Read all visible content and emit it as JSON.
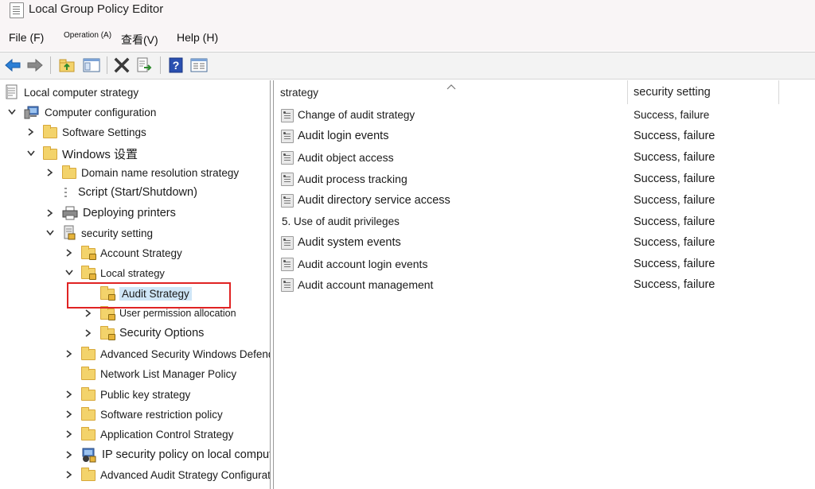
{
  "window": {
    "title": "Local Group Policy Editor"
  },
  "menu": {
    "file": "File (F)",
    "operation": "Operation (A)",
    "view": "查看(V)",
    "help": "Help (H)"
  },
  "toolbar": {
    "icons": [
      "back-arrow-icon",
      "forward-arrow-icon",
      "up-folder-icon",
      "show-hide-tree-icon",
      "delete-icon",
      "export-list-icon",
      "help-icon",
      "properties-pane-icon"
    ]
  },
  "tree": {
    "root": "Local computer strategy",
    "computer_config": "Computer configuration",
    "software_settings": "Software Settings",
    "windows_settings": "Windows 设置",
    "domain_name_resolution": "Domain name resolution strategy",
    "script": "Script (Start/Shutdown)",
    "deploying_printers": "Deploying printers",
    "security_setting": "security setting",
    "account_strategy": "Account Strategy",
    "local_strategy": "Local strategy",
    "audit_strategy": "Audit Strategy",
    "user_permission": "User permission allocation",
    "security_options": "Security Options",
    "advanced_security_defender": "Advanced Security Windows Defender",
    "network_list_manager": "Network List Manager Policy",
    "public_key": "Public key strategy",
    "software_restriction": "Software restriction policy",
    "application_control": "Application Control Strategy",
    "ip_security": "IP security policy on local computer",
    "advanced_audit_config": "Advanced Audit Strategy Configuration"
  },
  "list": {
    "columns": {
      "strategy": "strategy",
      "setting": "security setting"
    },
    "rows": [
      {
        "name": "Change of audit strategy",
        "setting": "Success, failure"
      },
      {
        "name": "Audit login events",
        "setting": "Success, failure"
      },
      {
        "name": "Audit object access",
        "setting": "Success, failure"
      },
      {
        "name": "Audit process tracking",
        "setting": "Success, failure"
      },
      {
        "name": "Audit directory service access",
        "setting": "Success, failure"
      },
      {
        "name": "5. Use of audit privileges",
        "setting": "Success, failure"
      },
      {
        "name": "Audit system events",
        "setting": "Success, failure"
      },
      {
        "name": "Audit account login events",
        "setting": "Success, failure"
      },
      {
        "name": "Audit account management",
        "setting": "Success, failure"
      }
    ]
  },
  "colors": {
    "highlight_box": "#e02323",
    "selection": "#cfe6f7",
    "folder": "#f3d36b"
  }
}
